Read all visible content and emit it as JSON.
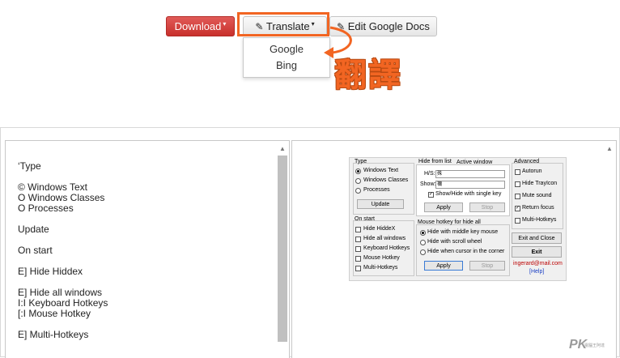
{
  "toolbar": {
    "download_label": "Download",
    "translate_label": "Translate",
    "edit_label": "Edit Google Docs"
  },
  "translate_menu": {
    "items": [
      "Google",
      "Bing"
    ]
  },
  "annotation": {
    "text": "翻譯",
    "color": "#f26522"
  },
  "ocr_text": {
    "lines": [
      "‘Type",
      "© Windows Text",
      "O Windows Classes",
      "O Processes",
      "Update",
      "On start",
      "E] Hide Hiddex",
      "E] Hide all windows",
      "I:I Keyboard Hotkeys",
      "[:I Mouse Hotkey",
      "E] Multi-Hotkeys"
    ]
  },
  "screenshot": {
    "type_group": {
      "title": "Type",
      "options": [
        "Windows Text",
        "Windows Classes",
        "Processes"
      ],
      "selected": 0,
      "update": "Update"
    },
    "hide_tab": {
      "tabs": [
        "Hide from list",
        "Active window"
      ],
      "hs_label": "H/S:",
      "hs_value": "殊",
      "show_label": "Show:",
      "show_value": "禰",
      "single_key": "Show/Hide with single key",
      "apply": "Apply",
      "stop": "Stop"
    },
    "advanced": {
      "title": "Advanced",
      "options": [
        "Autorun",
        "Hide TrayIcon",
        "Mute sound",
        "Return focus",
        "Multi-Hotkeys"
      ],
      "checked": [
        3
      ]
    },
    "on_start": {
      "title": "On start",
      "options": [
        "Hide HiddeX",
        "Hide all windows",
        "Keyboard Hotkeys",
        "Mouse Hotkey",
        "Multi-Hotkeys"
      ]
    },
    "mouse": {
      "title": "Mouse hotkey for hide all",
      "options": [
        "Hide with middle key mouse",
        "Hide with scroll wheel",
        "Hide when cursor in the corner"
      ],
      "selected": 0,
      "apply": "Apply",
      "stop": "Stop"
    },
    "exit_close": "Exit and Close",
    "exit": "Exit",
    "email": "ingerard@mail.com",
    "help": "[Help]"
  },
  "watermark": {
    "text": "PK",
    "sub": "電腦王阿達"
  }
}
